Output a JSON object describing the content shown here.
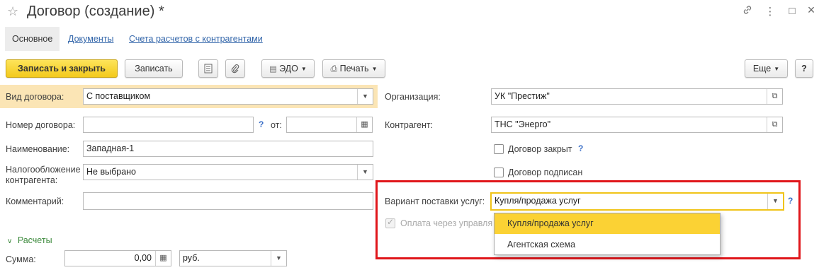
{
  "window": {
    "title": "Договор (создание) *",
    "star_icon": "☆",
    "link_icon": "🔗",
    "menu_icon": "⋮",
    "minimize_icon": "□",
    "close_icon": "×"
  },
  "tabs": [
    {
      "label": "Основное",
      "active": true
    },
    {
      "label": "Документы",
      "active": false
    },
    {
      "label": "Счета расчетов с контрагентами",
      "active": false
    }
  ],
  "toolbar": {
    "save_close": "Записать и закрыть",
    "save": "Записать",
    "edo": "ЭДО",
    "print": "Печать",
    "more": "Еще",
    "help": "?"
  },
  "form": {
    "contract_type": {
      "label": "Вид договора:",
      "value": "С поставщиком"
    },
    "contract_number": {
      "label": "Номер договора:",
      "value": "",
      "help": "?"
    },
    "date_from": {
      "label": "от:",
      "value": " .  ."
    },
    "name": {
      "label": "Наименование:",
      "value": "Западная-1"
    },
    "taxation": {
      "label": "Налогообложение контрагента:",
      "value": "Не выбрано"
    },
    "comment": {
      "label": "Комментарий:",
      "value": ""
    },
    "organization": {
      "label": "Организация:",
      "value": "УК \"Престиж\""
    },
    "counterparty": {
      "label": "Контрагент:",
      "value": "ТНС \"Энерго\""
    },
    "contract_closed": {
      "label": "Договор закрыт",
      "checked": false,
      "help": "?"
    },
    "contract_signed": {
      "label": "Договор подписан",
      "checked": false
    },
    "service_variant": {
      "label": "Вариант поставки услуг:",
      "value": "Купля/продажа услуг",
      "help": "?"
    },
    "payment_via": {
      "label": "Оплата через управля",
      "checked": true
    },
    "service_options": [
      "Купля/продажа услуг",
      "Агентская схема"
    ]
  },
  "settlements": {
    "section_label": "Расчеты",
    "sum_label": "Сумма:",
    "sum_value": "0,00",
    "currency": "руб."
  },
  "colors": {
    "accent_yellow": "#f3c91c",
    "highlight": "#fbe5b5",
    "annotation_red": "#e0161b",
    "link_blue": "#3366aa",
    "section_green": "#3d8a3d"
  }
}
